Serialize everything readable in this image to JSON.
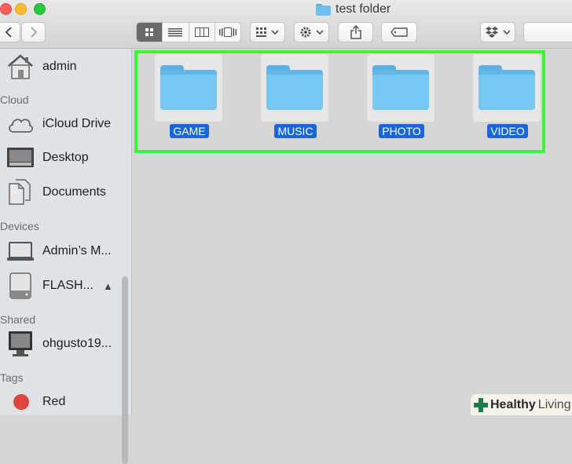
{
  "window": {
    "title": "test folder"
  },
  "toolbar": {
    "back_icon": "chevron-left-icon",
    "forward_icon": "chevron-right-icon",
    "view_modes": [
      "icon-view-icon",
      "list-view-icon",
      "column-view-icon",
      "cover-flow-icon"
    ],
    "arrange_icon": "arrange-grid-icon",
    "action_icon": "gear-icon",
    "share_icon": "share-icon",
    "tag_icon": "tag-icon",
    "dropbox_icon": "dropbox-icon"
  },
  "sidebar": {
    "favorites": [
      {
        "label": "admin",
        "icon": "home-icon"
      }
    ],
    "icloud_header": "Cloud",
    "icloud": [
      {
        "label": "iCloud Drive",
        "icon": "cloud-icon"
      },
      {
        "label": "Desktop",
        "icon": "desktop-icon"
      },
      {
        "label": "Documents",
        "icon": "documents-icon"
      }
    ],
    "devices_header": "Devices",
    "devices": [
      {
        "label": "Admin’s M...",
        "icon": "laptop-icon"
      },
      {
        "label": "FLASH...",
        "icon": "disk-icon",
        "eject": "▲"
      }
    ],
    "shared_header": "Shared",
    "shared": [
      {
        "label": "ohgusto19...",
        "icon": "monitor-icon"
      }
    ],
    "tags_header": "Tags",
    "tags": [
      {
        "label": "Red",
        "color": "#e0443e"
      }
    ]
  },
  "content": {
    "folders": [
      {
        "label": "GAME"
      },
      {
        "label": "MUSIC"
      },
      {
        "label": "PHOTO"
      },
      {
        "label": "VIDEO"
      }
    ],
    "selection_color": "#3ef23e",
    "label_highlight_color": "#1866d9"
  },
  "watermark": {
    "brand_a": "Healthy",
    "brand_b": "Living"
  }
}
